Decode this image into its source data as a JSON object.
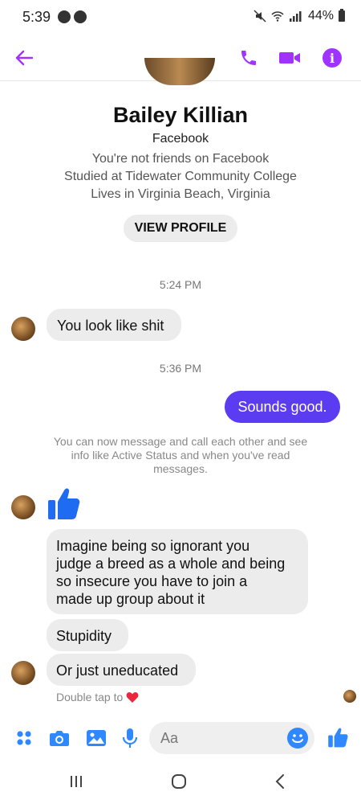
{
  "status_bar": {
    "time": "5:39",
    "battery": "44%"
  },
  "header": {
    "back_icon": "back-arrow-icon",
    "call_icon": "phone-icon",
    "video_icon": "video-camera-icon",
    "info_icon": "info-icon",
    "info_glyph": "i"
  },
  "profile": {
    "name": "Bailey Killian",
    "platform": "Facebook",
    "lines": [
      "You're not friends on Facebook",
      "Studied at Tidewater Community College",
      "Lives in Virginia Beach, Virginia"
    ],
    "view_profile_label": "VIEW PROFILE"
  },
  "conversation": {
    "time_1": "5:24 PM",
    "msg_1": "You look like shit",
    "time_2": "5:36 PM",
    "msg_out_1": "Sounds good.",
    "system_message": "You can now message and call each other and see info like Active Status and when you've read messages.",
    "msg_2_lines": [
      "Imagine being so ignorant you",
      "judge a breed as a whole and being",
      "so insecure you have to join a",
      "made up group about it"
    ],
    "msg_3": "Stupidity",
    "msg_4": "Or just uneducated",
    "reaction_hint": "Double tap to"
  },
  "composer": {
    "placeholder": "Aa"
  },
  "colors": {
    "accent": "#a033ff",
    "outgoing_bubble": "#5b3cf0",
    "composer_blue": "#2f88ff"
  }
}
